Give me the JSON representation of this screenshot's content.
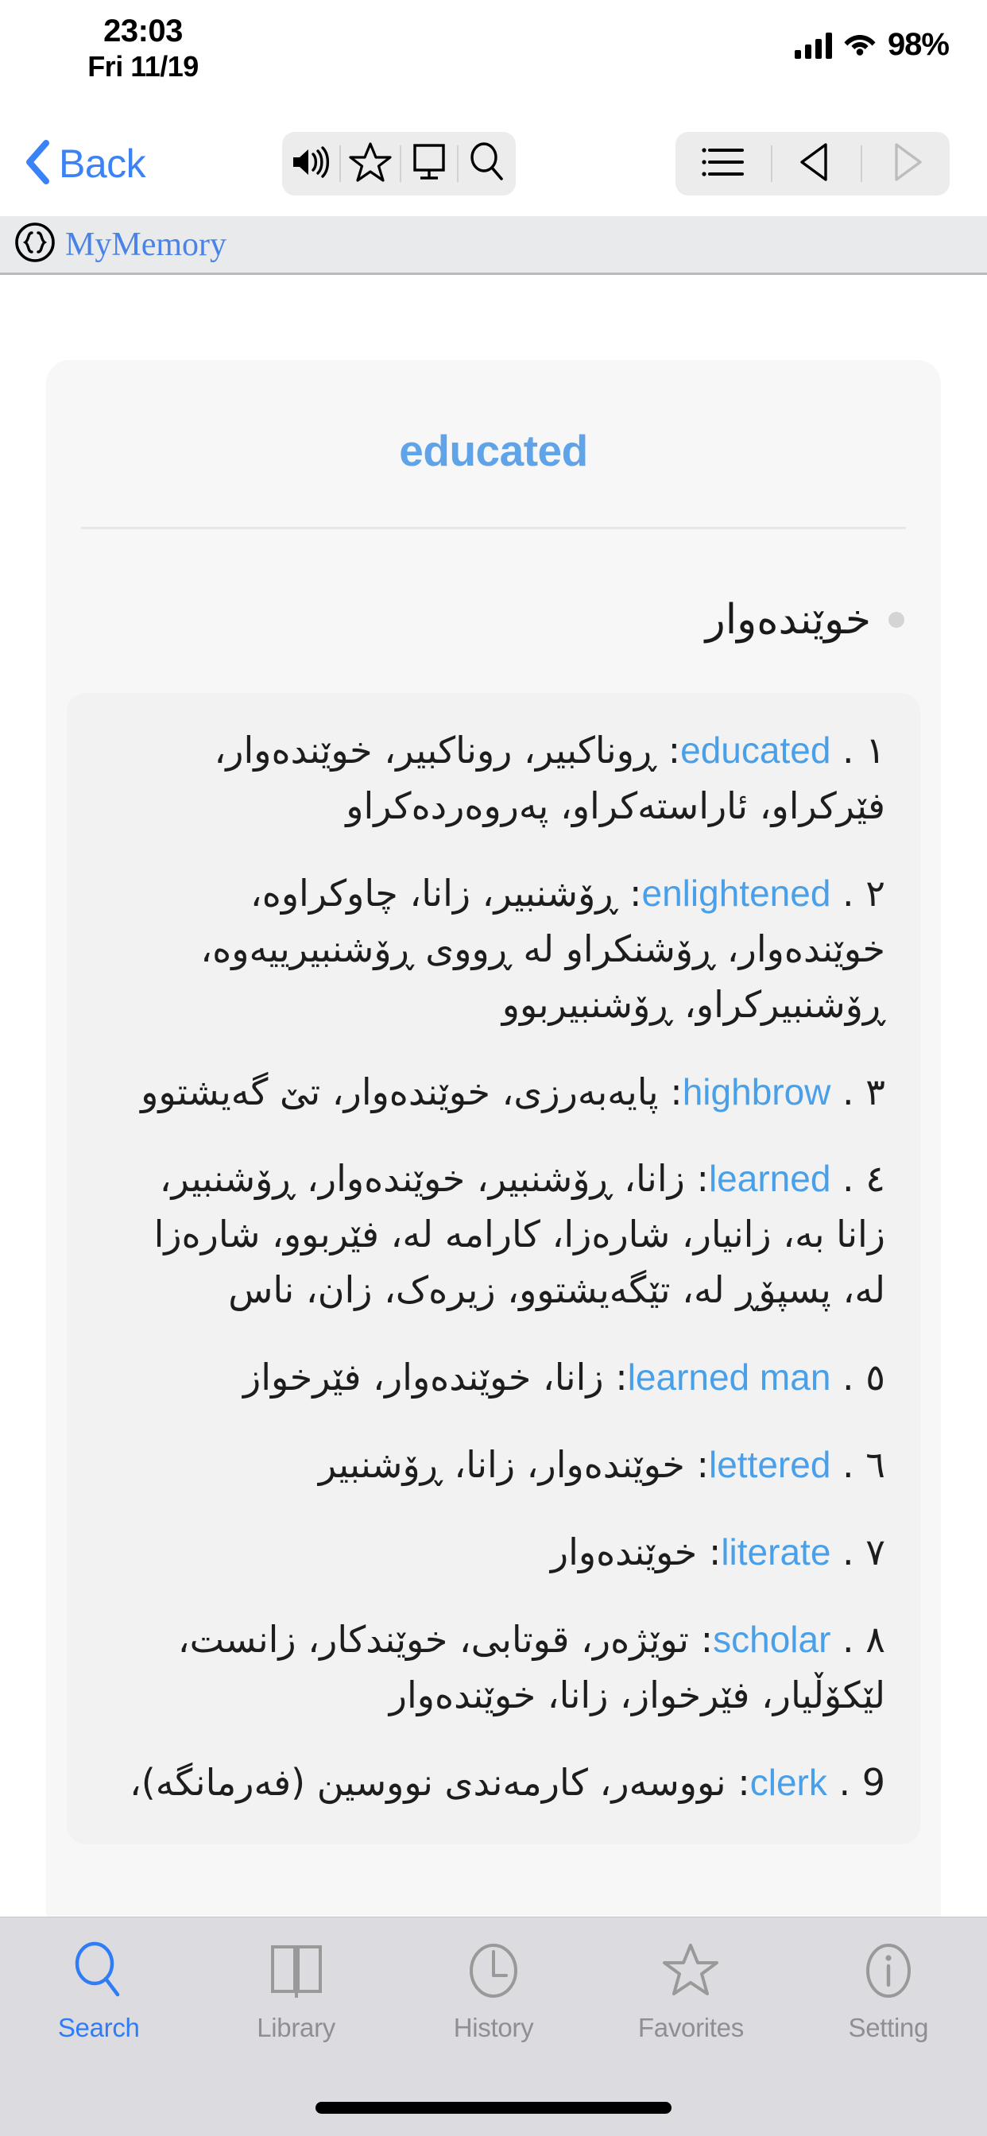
{
  "status_bar": {
    "time": "23:03",
    "date": "Fri 11/19",
    "battery": "98%"
  },
  "nav": {
    "back_label": "Back",
    "tools_left": [
      {
        "name": "speaker-icon",
        "label": "Pronounce"
      },
      {
        "name": "star-icon",
        "label": "Favorite"
      },
      {
        "name": "display-icon",
        "label": "Display"
      },
      {
        "name": "search-icon",
        "label": "Search"
      }
    ],
    "tools_right": [
      {
        "name": "list-icon",
        "label": "List"
      },
      {
        "name": "previous-icon",
        "label": "Previous"
      },
      {
        "name": "next-icon",
        "label": "Next"
      }
    ]
  },
  "source_bar": {
    "icon": "braces-circle-icon",
    "label": "MyMemory"
  },
  "entry": {
    "title": "educated",
    "headword": "خوێندەوار",
    "senses": [
      {
        "number": "١ .",
        "english": "educated",
        "kurdish": "ڕوناکبیر، روناکبیر، خوێندەوار، فێرکراو، ئاراستەکراو، پەروەردەکراو"
      },
      {
        "number": "٢ .",
        "english": "enlightened",
        "kurdish": "ڕۆشنبیر، زانا، چاوکراوە، خوێندەوار، ڕۆشنکراو لە ڕووی ڕۆشنبیرییەوە، ڕۆشنبیرکراو، ڕۆشنبیربوو"
      },
      {
        "number": "٣ .",
        "english": "highbrow",
        "kurdish": "پایەبەرزی، خوێندەوار، تێ گەیشتوو"
      },
      {
        "number": "٤ .",
        "english": "learned",
        "kurdish": "زانا، ڕۆشنبیر، خوێندەوار، ڕۆشنبیر، زانا بە، زانیار، شارەزا، کارامە لە، فێربوو، شارەزا لە، پسپۆڕ لە، تێگەیشتوو، زیرەک، زان، ناس"
      },
      {
        "number": "٥ .",
        "english": "learned man",
        "kurdish": "زانا، خوێندەوار، فێرخواز"
      },
      {
        "number": "٦ .",
        "english": "lettered",
        "kurdish": "خوێندەوار، زانا، ڕۆشنبیر"
      },
      {
        "number": "٧ .",
        "english": "literate",
        "kurdish": "خوێندەوار"
      },
      {
        "number": "٨ .",
        "english": "scholar",
        "kurdish": "توێژەر، قوتابی، خوێندکار، زانست، لێکۆڵیار، فێرخواز، زانا، خوێندەوار"
      },
      {
        "number": "9 .",
        "english": "clerk",
        "kurdish": "نووسەر، کارمەندی نووسین (فەرمانگە)،"
      }
    ]
  },
  "tabbar": {
    "items": [
      {
        "label": "Search",
        "icon": "search-icon",
        "active": true
      },
      {
        "label": "Library",
        "icon": "book-icon",
        "active": false
      },
      {
        "label": "History",
        "icon": "clock-icon",
        "active": false
      },
      {
        "label": "Favorites",
        "icon": "star-icon",
        "active": false
      },
      {
        "label": "Setting",
        "icon": "info-icon",
        "active": false
      }
    ]
  },
  "colors": {
    "accent": "#2f7cf6",
    "title_blue": "#5fa3e8",
    "link_blue": "#4aa0e8",
    "tab_inactive": "#8e8e93"
  }
}
